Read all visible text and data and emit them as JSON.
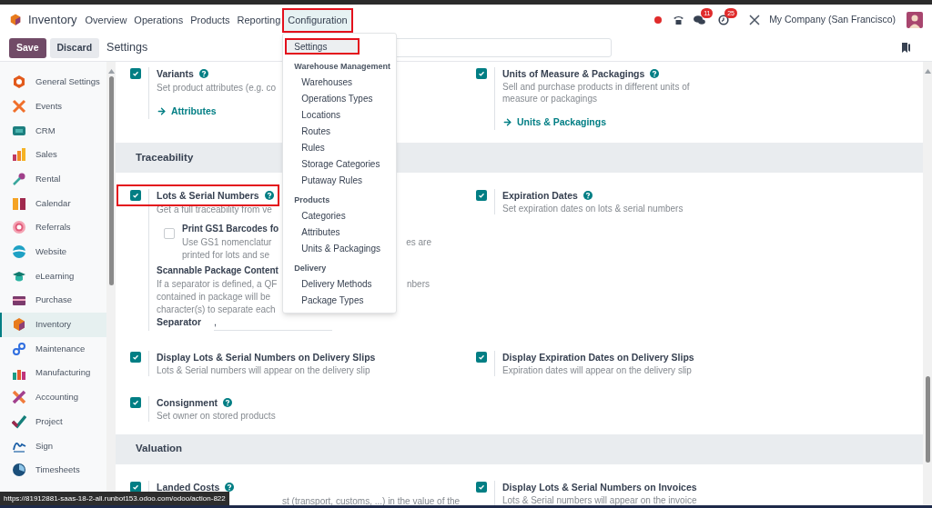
{
  "app": {
    "name": "Inventory"
  },
  "nav_menu": [
    {
      "label": "Overview",
      "highlighted": false
    },
    {
      "label": "Operations",
      "highlighted": false
    },
    {
      "label": "Products",
      "highlighted": false
    },
    {
      "label": "Reporting",
      "highlighted": false
    },
    {
      "label": "Configuration",
      "highlighted": true
    }
  ],
  "systray": {
    "chat_count": "11",
    "activity_count": "25",
    "company": "My Company (San Francisco)"
  },
  "control_panel": {
    "buttons": [
      {
        "label": "Save",
        "kind": "primary"
      },
      {
        "label": "Discard",
        "kind": "secondary"
      }
    ],
    "title": "Settings"
  },
  "config_menu": [
    {
      "kind": "item",
      "label": "Settings",
      "selected": true,
      "highlighted": true
    },
    {
      "kind": "heading",
      "label": "Warehouse Management"
    },
    {
      "kind": "item",
      "label": "Warehouses",
      "selected": false,
      "highlighted": false
    },
    {
      "kind": "item",
      "label": "Operations Types",
      "selected": false,
      "highlighted": false
    },
    {
      "kind": "item",
      "label": "Locations",
      "selected": false,
      "highlighted": false
    },
    {
      "kind": "item",
      "label": "Routes",
      "selected": false,
      "highlighted": false
    },
    {
      "kind": "item",
      "label": "Rules",
      "selected": false,
      "highlighted": false
    },
    {
      "kind": "item",
      "label": "Storage Categories",
      "selected": false,
      "highlighted": false
    },
    {
      "kind": "item",
      "label": "Putaway Rules",
      "selected": false,
      "highlighted": false
    },
    {
      "kind": "heading",
      "label": "Products"
    },
    {
      "kind": "item",
      "label": "Categories",
      "selected": false,
      "highlighted": false
    },
    {
      "kind": "item",
      "label": "Attributes",
      "selected": false,
      "highlighted": false
    },
    {
      "kind": "item",
      "label": "Units & Packagings",
      "selected": false,
      "highlighted": false
    },
    {
      "kind": "heading",
      "label": "Delivery"
    },
    {
      "kind": "item",
      "label": "Delivery Methods",
      "selected": false,
      "highlighted": false
    },
    {
      "kind": "item",
      "label": "Package Types",
      "selected": false,
      "highlighted": false
    }
  ],
  "sidebar": [
    {
      "label": "General Settings",
      "selected": false
    },
    {
      "label": "Events",
      "selected": false
    },
    {
      "label": "CRM",
      "selected": false
    },
    {
      "label": "Sales",
      "selected": false
    },
    {
      "label": "Rental",
      "selected": false
    },
    {
      "label": "Calendar",
      "selected": false
    },
    {
      "label": "Referrals",
      "selected": false
    },
    {
      "label": "Website",
      "selected": false
    },
    {
      "label": "eLearning",
      "selected": false
    },
    {
      "label": "Purchase",
      "selected": false
    },
    {
      "label": "Inventory",
      "selected": true
    },
    {
      "label": "Maintenance",
      "selected": false
    },
    {
      "label": "Manufacturing",
      "selected": false
    },
    {
      "label": "Accounting",
      "selected": false
    },
    {
      "label": "Project",
      "selected": false
    },
    {
      "label": "Sign",
      "selected": false
    },
    {
      "label": "Timesheets",
      "selected": false
    }
  ],
  "groups": [
    {
      "rows": [
        {
          "left": {
            "title": "Variants",
            "help": true,
            "checked": true,
            "highlighted": false,
            "description": [
              {
                "before_menu": "Set product attributes (e.g. co"
              }
            ],
            "link": "Attributes"
          },
          "right": {
            "title": "Units of Measure & Packagings",
            "help": true,
            "checked": true,
            "highlighted": false,
            "description": "Sell and purchase products in different units of measure or packagings",
            "link": "Units & Packagings"
          }
        }
      ]
    },
    {
      "heading": "Traceability",
      "rows": [
        {
          "left": {
            "title": "Lots & Serial Numbers",
            "help": true,
            "checked": true,
            "highlighted": true,
            "description": [
              {
                "before_menu": "Get a full traceability from ve"
              }
            ],
            "options": [
              {
                "kind": "checkbox",
                "title": "Print GS1 Barcodes fo",
                "checked": false,
                "description": [
                  {
                    "before_menu": "Use GS1 nomenclatur",
                    "after_menu": "es are"
                  },
                  {
                    "before_menu": "printed for lots and se"
                  }
                ]
              },
              {
                "kind": "field",
                "title": "Scannable Package Content",
                "description": [
                  {
                    "before_menu": "If a separator is defined, a QF",
                    "after_menu": "nbers"
                  },
                  {
                    "before_menu": "contained in package will be"
                  },
                  {
                    "before_menu": "character(s) to separate each"
                  }
                ],
                "field_label": "Separator",
                "value": ","
              }
            ]
          },
          "right": {
            "title": "Expiration Dates",
            "help": true,
            "checked": true,
            "highlighted": false,
            "description": "Set expiration dates on lots & serial numbers"
          }
        },
        {
          "left": {
            "title": "Display Lots & Serial Numbers on Delivery Slips",
            "help": false,
            "checked": true,
            "highlighted": false,
            "description": "Lots & Serial numbers will appear on the delivery slip"
          },
          "right": {
            "title": "Display Expiration Dates on Delivery Slips",
            "help": false,
            "checked": true,
            "highlighted": false,
            "description": "Expiration dates will appear on the delivery slip"
          }
        },
        {
          "left": {
            "title": "Consignment",
            "help": true,
            "checked": true,
            "highlighted": false,
            "description": "Set owner on stored products"
          }
        }
      ]
    },
    {
      "heading": "Valuation",
      "rows": [
        {
          "left": {
            "title": "Landed Costs",
            "help": true,
            "checked": true,
            "highlighted": false,
            "description": [
              {
                "after_status_bar": "st (transport, customs, ...) in the value of the"
              }
            ]
          },
          "right": {
            "title": "Display Lots & Serial Numbers on Invoices",
            "help": false,
            "checked": true,
            "highlighted": false,
            "description": "Lots & Serial numbers will appear on the invoice"
          }
        }
      ]
    }
  ],
  "status_url": "https://81912881-saas-18-2-all.runbot153.odoo.com/odoo/action-822"
}
